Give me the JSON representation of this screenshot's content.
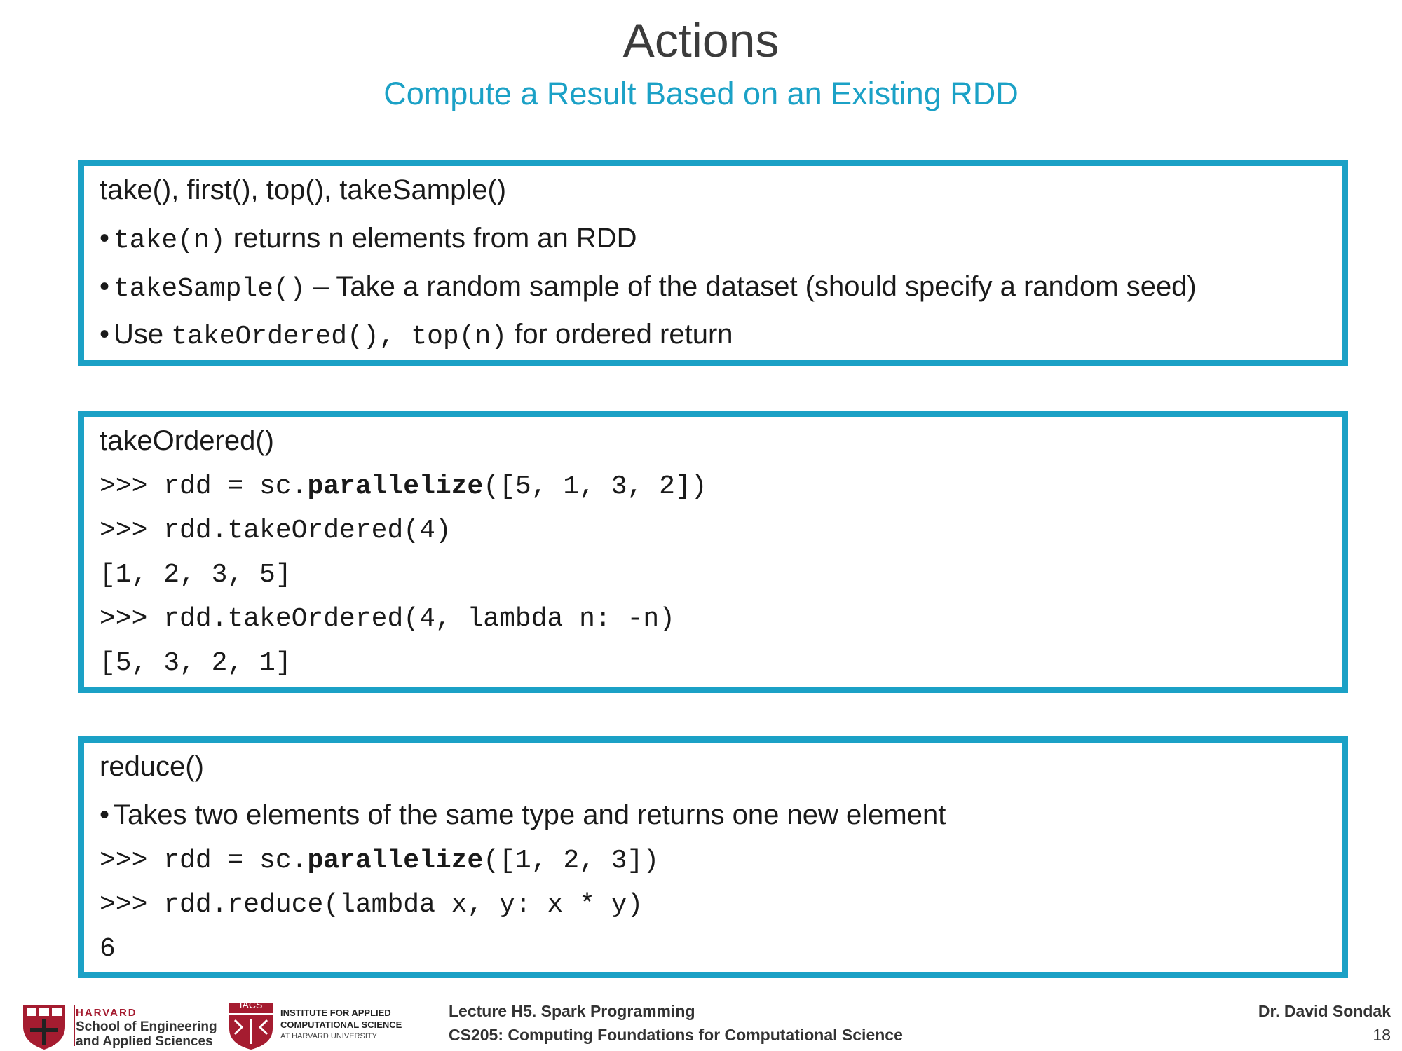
{
  "slide": {
    "title": "Actions",
    "subtitle": "Compute a Result Based on an Existing RDD",
    "page_number": "18"
  },
  "box1": {
    "heading": "take(), first(), top(), takeSample()",
    "bullets": [
      {
        "code": "take(n)",
        "text": " returns n elements from an RDD"
      },
      {
        "code": "takeSample()",
        "text": " – Take a random sample of the dataset (should specify a random seed)"
      },
      {
        "prefix": "Use ",
        "code": "takeOrdered(), top(n)",
        "text": " for ordered return"
      }
    ]
  },
  "box2": {
    "heading": "takeOrdered()",
    "code_lines": [
      {
        "pre": ">>> rdd = sc.",
        "bold": "parallelize",
        "post": "([5, 1, 3, 2])"
      },
      {
        "pre": ">>> rdd.takeOrdered(4)"
      },
      {
        "pre": "[1, 2, 3, 5]"
      },
      {
        "pre": ">>> rdd.takeOrdered(4, lambda n: -n)"
      },
      {
        "pre": "[5, 3, 2, 1]"
      }
    ]
  },
  "box3": {
    "heading": "reduce()",
    "bullet": "Takes two elements of the same type and returns one new element",
    "code_lines": [
      {
        "pre": ">>> rdd = sc.",
        "bold": "parallelize",
        "post": "([1, 2, 3])"
      },
      {
        "pre": ">>> rdd.reduce(lambda x, y: x * y)"
      },
      {
        "pre": "6"
      }
    ]
  },
  "footer": {
    "harvard_word": "HARVARD",
    "school_line1": "School of Engineering",
    "school_line2": "and Applied Sciences",
    "iacs_badge": "IACS",
    "iacs_line1": "INSTITUTE FOR APPLIED",
    "iacs_line2": "COMPUTATIONAL SCIENCE",
    "iacs_line3": "AT HARVARD UNIVERSITY",
    "lecture": "Lecture H5. Spark Programming",
    "course": "CS205: Computing Foundations for Computational Science",
    "author": "Dr. David Sondak"
  },
  "colors": {
    "accent": "#1ba1c6",
    "harvard_crimson": "#a51c30"
  }
}
